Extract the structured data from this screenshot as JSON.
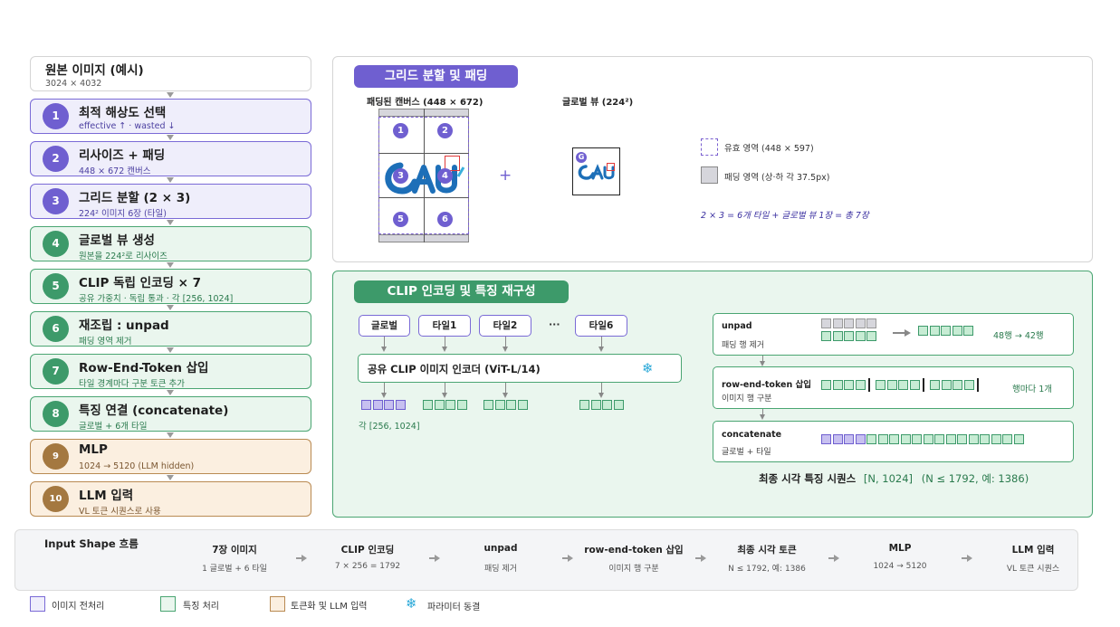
{
  "steps": [
    {
      "num": "",
      "title": "원본 이미지 (예시)",
      "sub": "3024 × 4032",
      "group": "white"
    },
    {
      "num": "1",
      "title": "최적 해상도 선택",
      "sub": "effective ↑ · wasted ↓",
      "group": "purple"
    },
    {
      "num": "2",
      "title": "리사이즈 + 패딩",
      "sub": "448 × 672 캔버스",
      "group": "purple"
    },
    {
      "num": "3",
      "title": "그리드 분할 (2 × 3)",
      "sub": "224² 이미지 6장 (타일)",
      "group": "purple"
    },
    {
      "num": "4",
      "title": "글로벌 뷰 생성",
      "sub": "원본을 224²로 리사이즈",
      "group": "green"
    },
    {
      "num": "5",
      "title": "CLIP 독립 인코딩 × 7",
      "sub": "공유 가중치 · 독립 통과 · 각 [256, 1024]",
      "group": "green"
    },
    {
      "num": "6",
      "title": "재조립 : unpad",
      "sub": "패딩 영역 제거",
      "group": "green"
    },
    {
      "num": "7",
      "title": "Row-End-Token 삽입",
      "sub": "타일 경계마다 구분 토큰 추가",
      "group": "green"
    },
    {
      "num": "8",
      "title": "특징 연결 (concatenate)",
      "sub": "글로벌 + 6개 타일",
      "group": "green"
    },
    {
      "num": "9",
      "title": "MLP",
      "sub": "1024 → 5120 (LLM hidden)",
      "group": "orange"
    },
    {
      "num": "10",
      "title": "LLM 입력",
      "sub": "VL 토큰 시퀀스로 사용",
      "group": "orange"
    }
  ],
  "grid_panel": {
    "title": "그리드 분할 및 패딩",
    "canvas_label": "패딩된 캔버스 (448 × 672)",
    "global_label": "글로벌 뷰 (224²)",
    "tiles": [
      "1",
      "2",
      "3",
      "4",
      "5",
      "6"
    ],
    "plus": "+",
    "global_badge": "G",
    "logo_text": "CAU",
    "legend_valid": "유효 영역 (448 × 597)",
    "legend_pad": "패딩 영역 (상·하 각 37.5px)",
    "formula": "2 × 3 = 6개 타일 + 글로벌 뷰 1장 = 총 7장"
  },
  "clip_panel": {
    "title": "CLIP 인코딩 및 특징 재구성",
    "inputs": [
      "글로벌",
      "타일1",
      "타일2",
      "···",
      "타일6"
    ],
    "encoder": "공유 CLIP 이미지 인코더 (ViT-L/14)",
    "snowflake": "❄",
    "each_label": "각 [256, 1024]",
    "unpad_title": "unpad",
    "unpad_sub": "패딩 행 제거",
    "unpad_note": "48행 → 42행",
    "ret_title": "row-end-token 삽입",
    "ret_sub": "이미지 행 구분",
    "ret_note": "행마다 1개",
    "concat_title": "concatenate",
    "concat_sub": "글로벌 + 타일",
    "final_label": "최종 시각 특징 시퀀스",
    "final_shape": "[N, 1024]",
    "final_note": "(N ≤ 1792, 예: 1386)"
  },
  "flow": {
    "title": "Input Shape 흐름",
    "items": [
      {
        "title": "7장 이미지",
        "sub": "1 글로벌 + 6 타일"
      },
      {
        "title": "CLIP 인코딩",
        "sub": "7 × 256 = 1792"
      },
      {
        "title": "unpad",
        "sub": "패딩 제거"
      },
      {
        "title": "row-end-token 삽입",
        "sub": "이미지 행 구분"
      },
      {
        "title": "최종 시각 토큰",
        "sub": "N ≤ 1792, 예: 1386"
      },
      {
        "title": "MLP",
        "sub": "1024 → 5120"
      },
      {
        "title": "LLM 입력",
        "sub": "VL 토큰 시퀀스"
      }
    ]
  },
  "legend": [
    {
      "label": "이미지 전처리",
      "color": "#efeefb",
      "border": "#7a6ad6"
    },
    {
      "label": "특징 처리",
      "color": "#eaf6ee",
      "border": "#4aa572"
    },
    {
      "label": "토큰화 및 LLM 입력",
      "color": "#fbefe0",
      "border": "#b98a52"
    },
    {
      "label": "파라미터 동결",
      "icon": "snowflake-icon"
    }
  ],
  "colors": {
    "purple": "#6f5fd0",
    "green": "#3d9a6a",
    "orange": "#a47840"
  }
}
